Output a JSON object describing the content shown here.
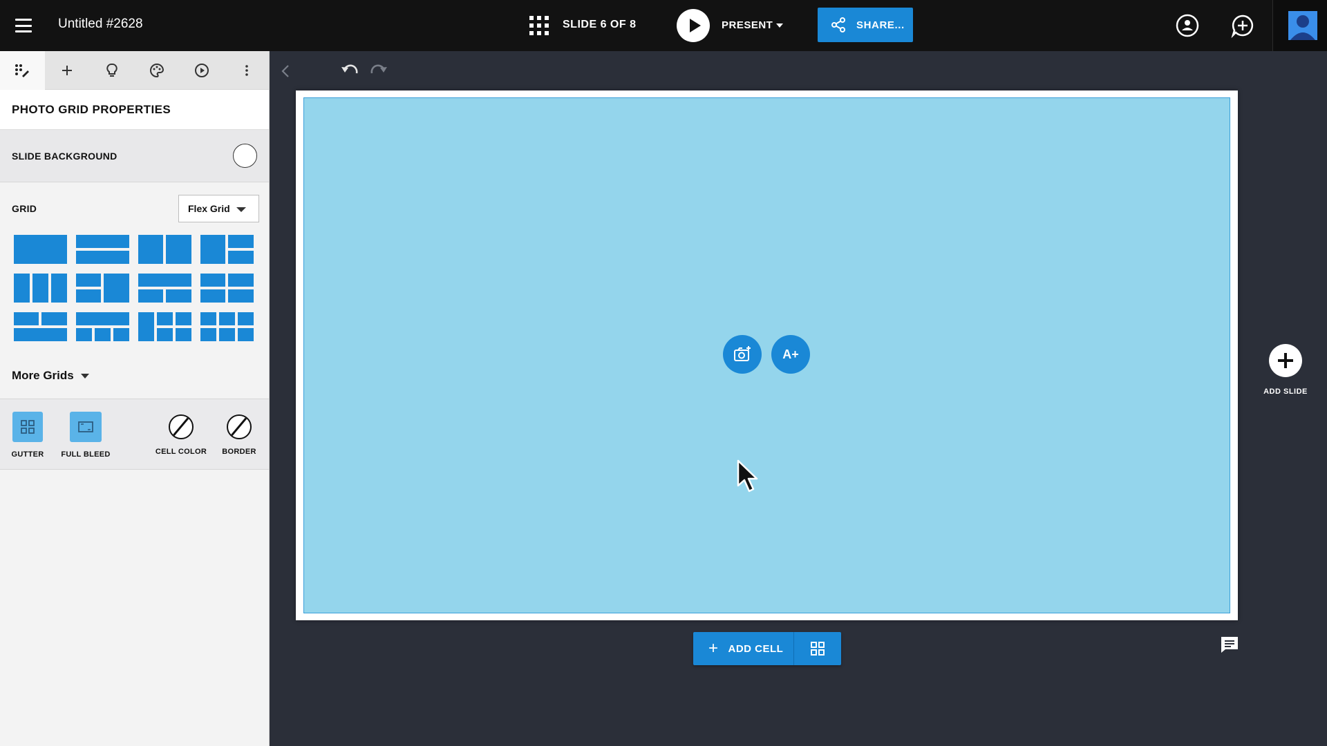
{
  "topbar": {
    "document_title": "Untitled #2628",
    "slide_counter": "SLIDE 6 OF 8",
    "present_label": "PRESENT",
    "share_label": "SHARE..."
  },
  "panel": {
    "tabs": [
      "layout-tools",
      "add",
      "ideas",
      "theme",
      "playback",
      "more"
    ],
    "header": "PHOTO GRID PROPERTIES",
    "slide_background_label": "SLIDE BACKGROUND",
    "slide_background_color": "#ffffff",
    "grid_label": "GRID",
    "grid_select_value": "Flex Grid",
    "more_grids_label": "More Grids",
    "options": {
      "gutter": "GUTTER",
      "full_bleed": "FULL BLEED",
      "cell_color": "CELL COLOR",
      "border": "BORDER"
    }
  },
  "canvas": {
    "cell_color": "#94d5ec",
    "accent": "#1a88d6",
    "text_button_label": "A+",
    "add_cell_label": "ADD CELL",
    "add_slide_label": "ADD SLIDE"
  }
}
